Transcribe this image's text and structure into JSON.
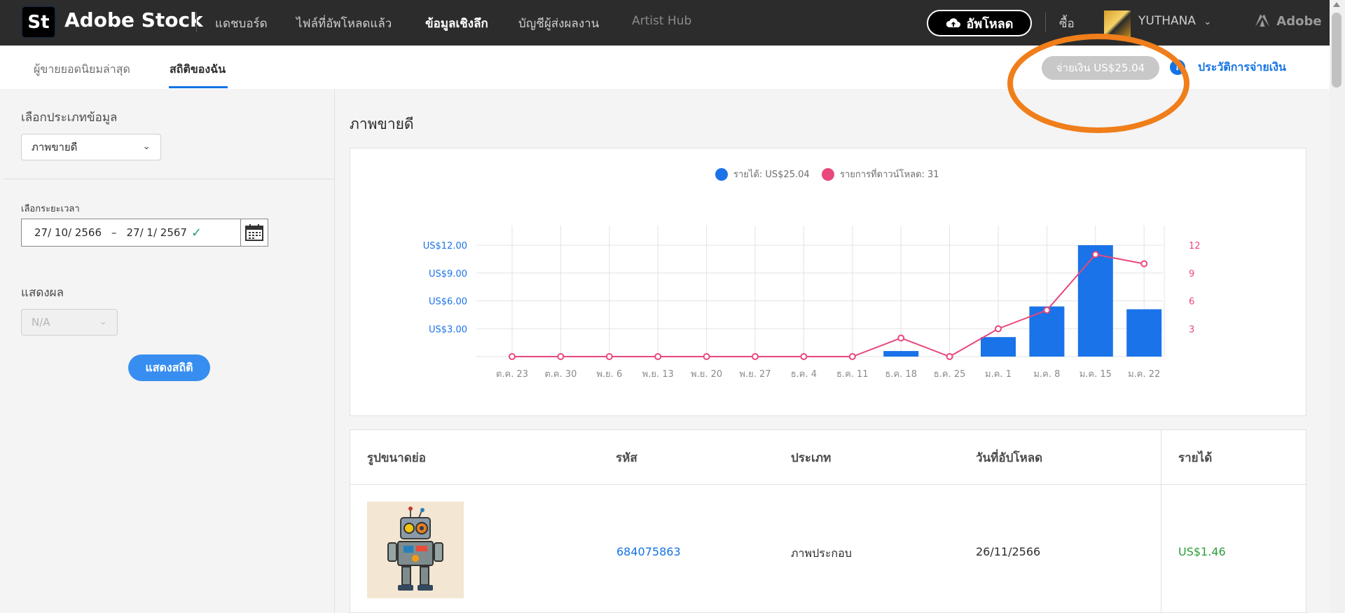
{
  "topnav": {
    "logo_text": "St",
    "brand": "Adobe Stock",
    "links": [
      "แดชบอร์ด",
      "ไฟล์ที่อัพโหลดแล้ว",
      "ข้อมูลเชิงลึก",
      "บัญชีผู้ส่งผลงาน",
      "Artist Hub"
    ],
    "upload_label": "อัพโหลด",
    "buy_label": "ซื้อ",
    "username": "YUTHANA",
    "adobe_label": "Adobe"
  },
  "subnav": {
    "tabs": [
      "ผู้ขายยอดนิยมล่าสุด",
      "สถิติของฉัน"
    ],
    "payment_label": "จ่ายเงิน US$25.04",
    "help_symbol": "?",
    "history_label": "ประวัติการจ่ายเงิน"
  },
  "sidebar": {
    "data_type_label": "เลือกประเภทข้อมูล",
    "data_type_value": "ภาพขายดี",
    "range_label": "เลือกระยะเวลา",
    "date_from": "27/ 10/ 2566",
    "date_sep": "–",
    "date_to": "27/ 1/ 2567",
    "display_label": "แสดงผล",
    "display_value": "N/A",
    "show_button": "แสดงสถิติ"
  },
  "main": {
    "title": "ภาพขายดี",
    "legend": [
      "รายได้: US$25.04",
      "รายการที่ดาวน์โหลด: 31"
    ]
  },
  "chart_data": {
    "type": "bar",
    "categories": [
      "ต.ค. 23",
      "ต.ค. 30",
      "พ.ย. 6",
      "พ.ย. 13",
      "พ.ย. 20",
      "พ.ย. 27",
      "ธ.ค. 4",
      "ธ.ค. 11",
      "ธ.ค. 18",
      "ธ.ค. 25",
      "ม.ค. 1",
      "ม.ค. 8",
      "ม.ค. 15",
      "ม.ค. 22"
    ],
    "series": [
      {
        "name": "รายได้: US$25.04",
        "type": "bar",
        "axis": "left",
        "color": "#1a73e8",
        "values": [
          0,
          0,
          0,
          0,
          0,
          0,
          0,
          0,
          0.6,
          0,
          2.1,
          5.4,
          12.0,
          5.1
        ]
      },
      {
        "name": "รายการที่ดาวน์โหลด: 31",
        "type": "line",
        "axis": "right",
        "color": "#e8487b",
        "values": [
          0,
          0,
          0,
          0,
          0,
          0,
          0,
          0,
          2,
          0,
          3,
          5,
          11,
          10
        ]
      }
    ],
    "left_ticks": [
      "US$3.00",
      "US$6.00",
      "US$9.00",
      "US$12.00"
    ],
    "right_ticks": [
      "3",
      "6",
      "9",
      "12"
    ],
    "ylim_left": [
      0,
      12
    ],
    "ylim_right": [
      0,
      12
    ],
    "grid": true,
    "legend_position": "top"
  },
  "table": {
    "headers": [
      "รูปขนาดย่อ",
      "รหัส",
      "ประเภท",
      "วันที่อัปโหลด",
      "รายได้"
    ],
    "rows": [
      {
        "id": "684075863",
        "type": "ภาพประกอบ",
        "upload_date": "26/11/2566",
        "earnings": "US$1.46"
      }
    ]
  }
}
